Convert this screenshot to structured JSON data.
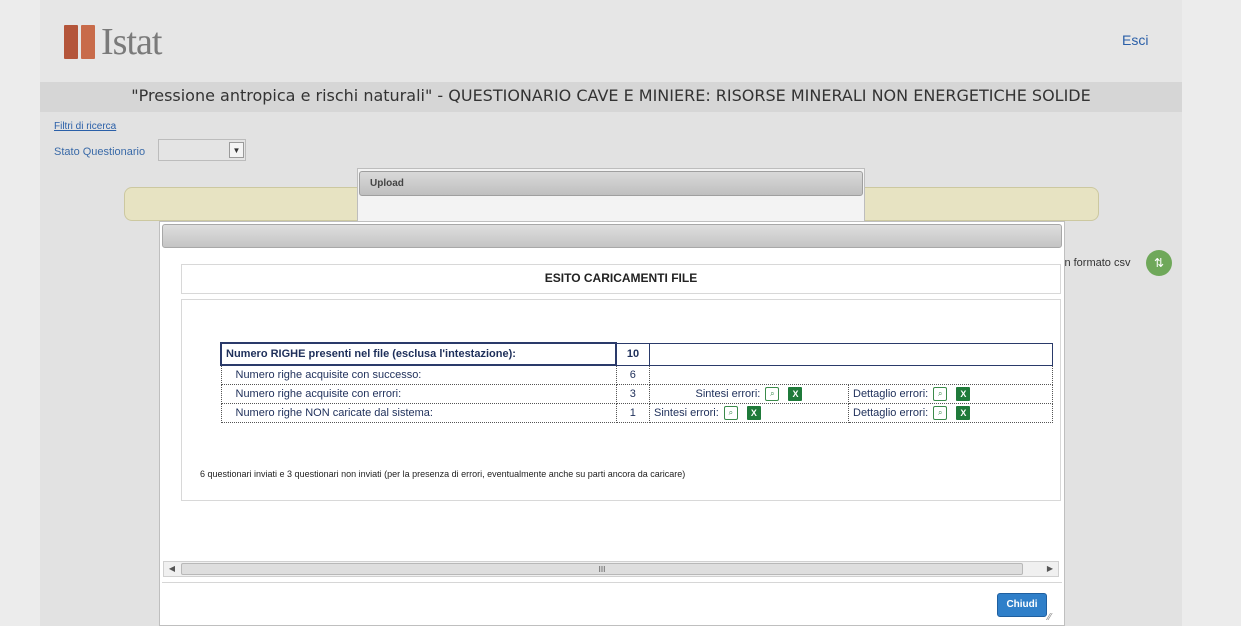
{
  "header": {
    "logo_text": "Istat",
    "logout_label": "Esci",
    "page_title": "\"Pressione antropica e rischi naturali\" - QUESTIONARIO CAVE E MINIERE: RISORSE MINERALI NON ENERGETICHE SOLIDE"
  },
  "filters": {
    "link_label": "Filtri di ricerca",
    "stato_label": "Stato Questionario",
    "stato_value": ""
  },
  "csv": {
    "label": "in formato csv",
    "icon": "upload-icon"
  },
  "upload_dialog": {
    "title": "Upload"
  },
  "modal": {
    "title": "ESITO CARICAMENTI FILE",
    "rows": [
      {
        "label": "Numero RIGHE presenti nel file (esclusa l'intestazione):",
        "value": "10"
      },
      {
        "label": "Numero righe acquisite con successo:",
        "value": "6"
      },
      {
        "label": "Numero righe acquisite con errori:",
        "value": "3",
        "sintesi": "Sintesi errori:",
        "dettaglio": "Dettaglio errori:"
      },
      {
        "label": "Numero righe NON caricate dal sistema:",
        "value": "1",
        "sintesi": "Sintesi errori:",
        "dettaglio": "Dettaglio errori:"
      }
    ],
    "summary": "6 questionari inviati e 3 questionari non inviati (per la presenza di errori, eventualmente anche su parti ancora da caricare)",
    "close_label": "Chiudi",
    "scroll_thumb_label": "III"
  },
  "icons": {
    "view": "search-document-icon",
    "excel": "excel-icon"
  },
  "colors": {
    "accent": "#2f7fc9",
    "brand": "#b4553a",
    "excel": "#1f7a3a"
  }
}
